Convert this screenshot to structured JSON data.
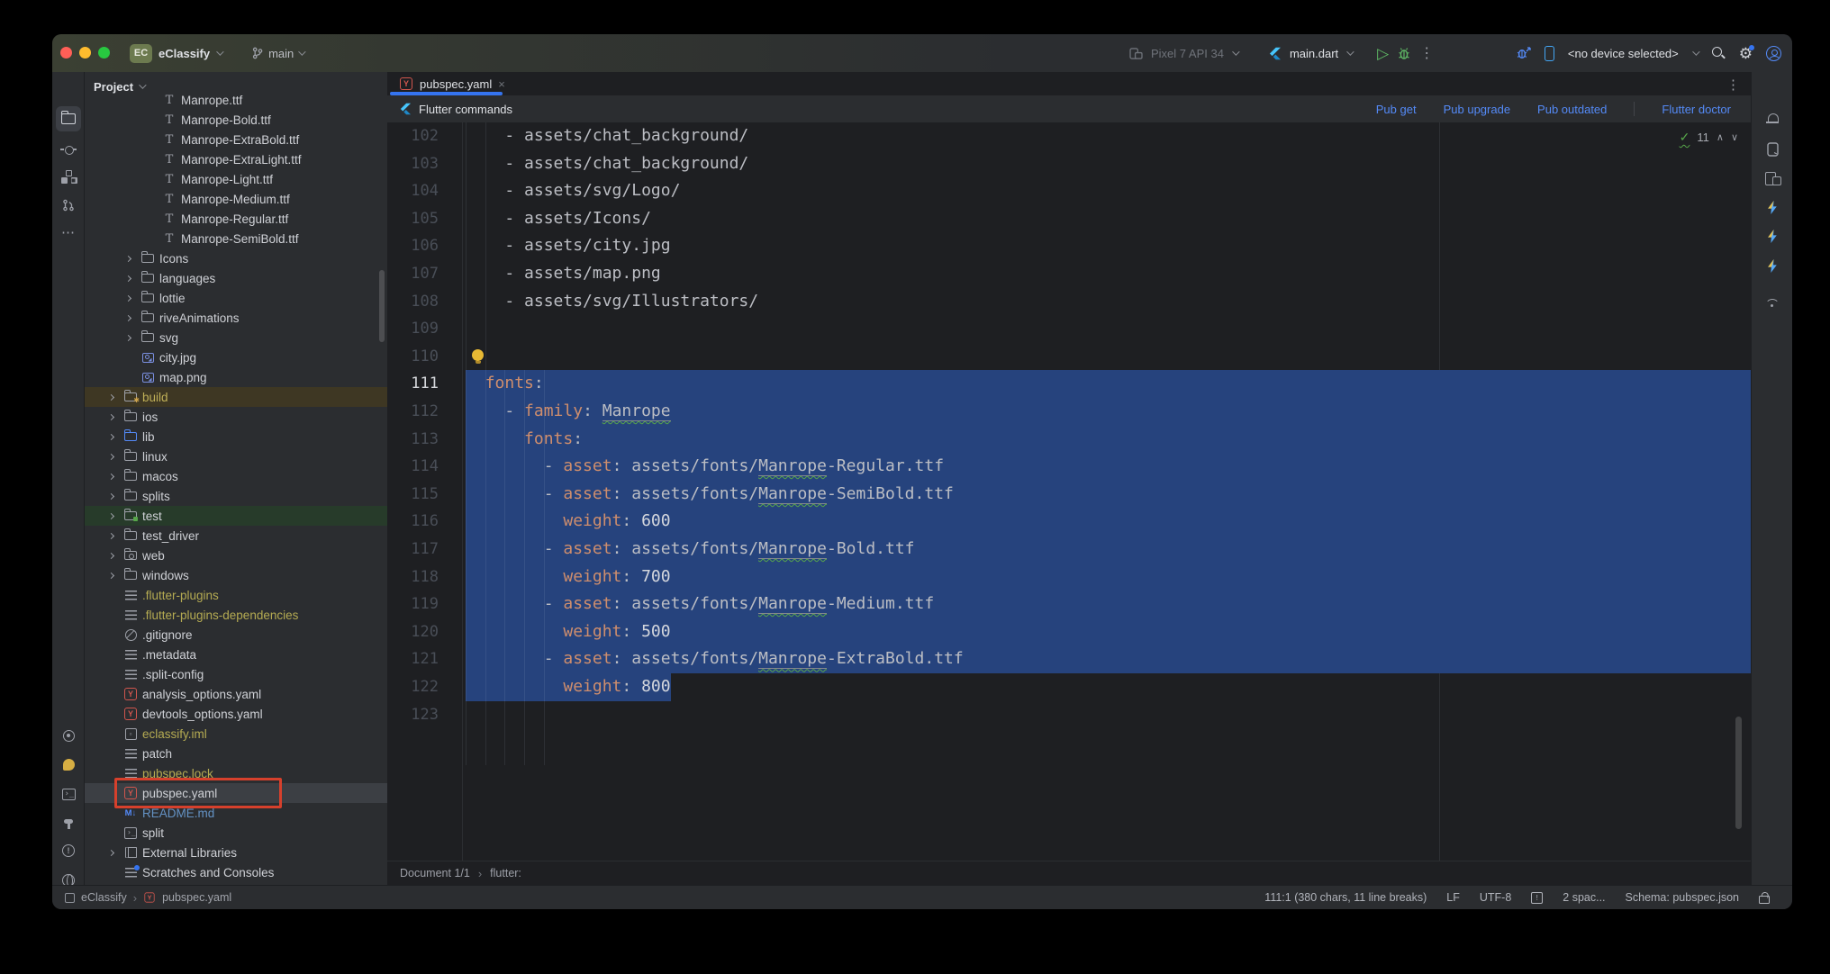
{
  "titlebar": {
    "project": "eClassify",
    "project_badge": "EC",
    "branch": "main",
    "device_config": "Pixel 7 API 34",
    "run_config": "main.dart",
    "no_device": "<no device selected>"
  },
  "project_panel": {
    "header": "Project",
    "items": [
      {
        "label": "Manrope.ttf",
        "ind": 2,
        "icon": "font"
      },
      {
        "label": "Manrope-Bold.ttf",
        "ind": 2,
        "icon": "font"
      },
      {
        "label": "Manrope-ExtraBold.ttf",
        "ind": 2,
        "icon": "font"
      },
      {
        "label": "Manrope-ExtraLight.ttf",
        "ind": 2,
        "icon": "font"
      },
      {
        "label": "Manrope-Light.ttf",
        "ind": 2,
        "icon": "font"
      },
      {
        "label": "Manrope-Medium.ttf",
        "ind": 2,
        "icon": "font"
      },
      {
        "label": "Manrope-Regular.ttf",
        "ind": 2,
        "icon": "font"
      },
      {
        "label": "Manrope-SemiBold.ttf",
        "ind": 2,
        "icon": "font"
      },
      {
        "label": "Icons",
        "ind": 1,
        "icon": "folder",
        "chev": true
      },
      {
        "label": "languages",
        "ind": 1,
        "icon": "folder",
        "chev": true
      },
      {
        "label": "lottie",
        "ind": 1,
        "icon": "folder",
        "chev": true
      },
      {
        "label": "riveAnimations",
        "ind": 1,
        "icon": "folder",
        "chev": true
      },
      {
        "label": "svg",
        "ind": 1,
        "icon": "folder",
        "chev": true
      },
      {
        "label": "city.jpg",
        "ind": 1,
        "icon": "img"
      },
      {
        "label": "map.png",
        "ind": 1,
        "icon": "img"
      },
      {
        "label": "build",
        "ind": 0,
        "icon": "folder-build",
        "chev": true,
        "row": "olive",
        "cls": "olivetext"
      },
      {
        "label": "ios",
        "ind": 0,
        "icon": "folder",
        "chev": true
      },
      {
        "label": "lib",
        "ind": 0,
        "icon": "folder-lib",
        "chev": true
      },
      {
        "label": "linux",
        "ind": 0,
        "icon": "folder",
        "chev": true
      },
      {
        "label": "macos",
        "ind": 0,
        "icon": "folder",
        "chev": true
      },
      {
        "label": "splits",
        "ind": 0,
        "icon": "folder",
        "chev": true
      },
      {
        "label": "test",
        "ind": 0,
        "icon": "folder-test",
        "chev": true,
        "row": "green"
      },
      {
        "label": "test_driver",
        "ind": 0,
        "icon": "folder",
        "chev": true
      },
      {
        "label": "web",
        "ind": 0,
        "icon": "folder-web",
        "chev": true
      },
      {
        "label": "windows",
        "ind": 0,
        "icon": "folder",
        "chev": true
      },
      {
        "label": ".flutter-plugins",
        "ind": 0,
        "icon": "list",
        "cls": "yellow"
      },
      {
        "label": ".flutter-plugins-dependencies",
        "ind": 0,
        "icon": "list",
        "cls": "yellow"
      },
      {
        "label": ".gitignore",
        "ind": 0,
        "icon": "ignored"
      },
      {
        "label": ".metadata",
        "ind": 0,
        "icon": "list"
      },
      {
        "label": ".split-config",
        "ind": 0,
        "icon": "list"
      },
      {
        "label": "analysis_options.yaml",
        "ind": 0,
        "icon": "yaml"
      },
      {
        "label": "devtools_options.yaml",
        "ind": 0,
        "icon": "yaml"
      },
      {
        "label": "eclassify.iml",
        "ind": 0,
        "icon": "iml",
        "cls": "yellow"
      },
      {
        "label": "patch",
        "ind": 0,
        "icon": "list"
      },
      {
        "label": "pubspec.lock",
        "ind": 0,
        "icon": "list",
        "cls": "yellow"
      },
      {
        "label": "pubspec.yaml",
        "ind": 0,
        "icon": "yaml",
        "row": "selected",
        "annotated": true
      },
      {
        "label": "README.md",
        "ind": 0,
        "icon": "md",
        "cls": "blue"
      },
      {
        "label": "split",
        "ind": 0,
        "icon": "term"
      },
      {
        "label": "External Libraries",
        "ind": 0,
        "icon": "lib2",
        "chev": true
      },
      {
        "label": "Scratches and Consoles",
        "ind": 0,
        "icon": "scratch"
      }
    ]
  },
  "editor": {
    "tab": "pubspec.yaml",
    "banner": "Flutter commands",
    "actions": [
      "Pub get",
      "Pub upgrade",
      "Pub outdated",
      "Flutter doctor"
    ],
    "inspections_count": "11",
    "breadcrumb_doc": "Document 1/1",
    "breadcrumb_node": "flutter:",
    "lines": [
      {
        "n": 102,
        "sel": "none",
        "tok": [
          [
            "    - assets/chat_background/",
            "p"
          ]
        ]
      },
      {
        "n": 103,
        "sel": "none",
        "tok": [
          [
            "    - assets/chat_background/",
            "p"
          ]
        ]
      },
      {
        "n": 104,
        "sel": "none",
        "tok": [
          [
            "    - assets/svg/Logo/",
            "p"
          ]
        ]
      },
      {
        "n": 105,
        "sel": "none",
        "tok": [
          [
            "    - assets/Icons/",
            "p"
          ]
        ]
      },
      {
        "n": 106,
        "sel": "none",
        "tok": [
          [
            "    - assets/city.jpg",
            "p"
          ]
        ]
      },
      {
        "n": 107,
        "sel": "none",
        "tok": [
          [
            "    - assets/map.png",
            "p"
          ]
        ]
      },
      {
        "n": 108,
        "sel": "none",
        "tok": [
          [
            "    - assets/svg/Illustrators/",
            "p"
          ]
        ]
      },
      {
        "n": 109,
        "sel": "none",
        "tok": []
      },
      {
        "n": 110,
        "sel": "none",
        "bulb": true,
        "tok": []
      },
      {
        "n": 111,
        "sel": "full",
        "current": true,
        "tok": [
          [
            "  ",
            "p"
          ],
          [
            "fonts",
            "k"
          ],
          [
            ":",
            "p"
          ]
        ]
      },
      {
        "n": 112,
        "sel": "full",
        "tok": [
          [
            "    - ",
            "p"
          ],
          [
            "family",
            "k"
          ],
          [
            ": ",
            "p"
          ],
          [
            "Manrope",
            "t"
          ]
        ]
      },
      {
        "n": 113,
        "sel": "full",
        "tok": [
          [
            "      ",
            "p"
          ],
          [
            "fonts",
            "k"
          ],
          [
            ":",
            "p"
          ]
        ]
      },
      {
        "n": 114,
        "sel": "full",
        "tok": [
          [
            "        - ",
            "p"
          ],
          [
            "asset",
            "k"
          ],
          [
            ": assets/fonts/",
            "p"
          ],
          [
            "Manrope",
            "t"
          ],
          [
            "-Regular.ttf",
            "p"
          ]
        ]
      },
      {
        "n": 115,
        "sel": "full",
        "tok": [
          [
            "        - ",
            "p"
          ],
          [
            "asset",
            "k"
          ],
          [
            ": assets/fonts/",
            "p"
          ],
          [
            "Manrope",
            "t"
          ],
          [
            "-SemiBold.ttf",
            "p"
          ]
        ]
      },
      {
        "n": 116,
        "sel": "full",
        "tok": [
          [
            "          ",
            "p"
          ],
          [
            "weight",
            "k"
          ],
          [
            ": ",
            "p"
          ],
          [
            "600",
            "v"
          ]
        ]
      },
      {
        "n": 117,
        "sel": "full",
        "tok": [
          [
            "        - ",
            "p"
          ],
          [
            "asset",
            "k"
          ],
          [
            ": assets/fonts/",
            "p"
          ],
          [
            "Manrope",
            "t"
          ],
          [
            "-Bold.ttf",
            "p"
          ]
        ]
      },
      {
        "n": 118,
        "sel": "full",
        "tok": [
          [
            "          ",
            "p"
          ],
          [
            "weight",
            "k"
          ],
          [
            ": ",
            "p"
          ],
          [
            "700",
            "v"
          ]
        ]
      },
      {
        "n": 119,
        "sel": "full",
        "tok": [
          [
            "        - ",
            "p"
          ],
          [
            "asset",
            "k"
          ],
          [
            ": assets/fonts/",
            "p"
          ],
          [
            "Manrope",
            "t"
          ],
          [
            "-Medium.ttf",
            "p"
          ]
        ]
      },
      {
        "n": 120,
        "sel": "full",
        "tok": [
          [
            "          ",
            "p"
          ],
          [
            "weight",
            "k"
          ],
          [
            ": ",
            "p"
          ],
          [
            "500",
            "v"
          ]
        ]
      },
      {
        "n": 121,
        "sel": "full",
        "tok": [
          [
            "        - ",
            "p"
          ],
          [
            "asset",
            "k"
          ],
          [
            ": assets/fonts/",
            "p"
          ],
          [
            "Manrope",
            "t"
          ],
          [
            "-ExtraBold.ttf",
            "p"
          ]
        ]
      },
      {
        "n": 122,
        "sel": "text",
        "tok": [
          [
            "          ",
            "p"
          ],
          [
            "weight",
            "k"
          ],
          [
            ": ",
            "p"
          ],
          [
            "800",
            "v"
          ]
        ]
      },
      {
        "n": 123,
        "sel": "none",
        "tok": []
      }
    ]
  },
  "statusbar": {
    "crumb_project": "eClassify",
    "crumb_file": "pubspec.yaml",
    "caret": "111:1 (380 chars, 11 line breaks)",
    "line_ending": "LF",
    "encoding": "UTF-8",
    "indent": "2 spac...",
    "schema": "Schema: pubspec.json"
  },
  "left_stripe_icons": [
    "project-folder",
    "commit",
    "structure",
    "pull-requests",
    "more",
    "run-services",
    "paint",
    "terminal",
    "build-hammer",
    "problems-info",
    "globe",
    "git-branch"
  ],
  "right_stripe_icons": [
    "notifications-bell",
    "running-devices-phone",
    "device-mirror",
    "layers",
    "flutter-bolt",
    "flutter-bolt",
    "flutter-bolt",
    "network-wifi"
  ],
  "colors": {
    "accent_blue": "#3574f0",
    "link_blue": "#548af7",
    "selection_blue": "#26437d",
    "yaml_key_orange": "#cf8e6d",
    "excluded_yellow": "#b5ab52",
    "annotation_red": "#d6402c",
    "typo_green": "#57a64a"
  }
}
